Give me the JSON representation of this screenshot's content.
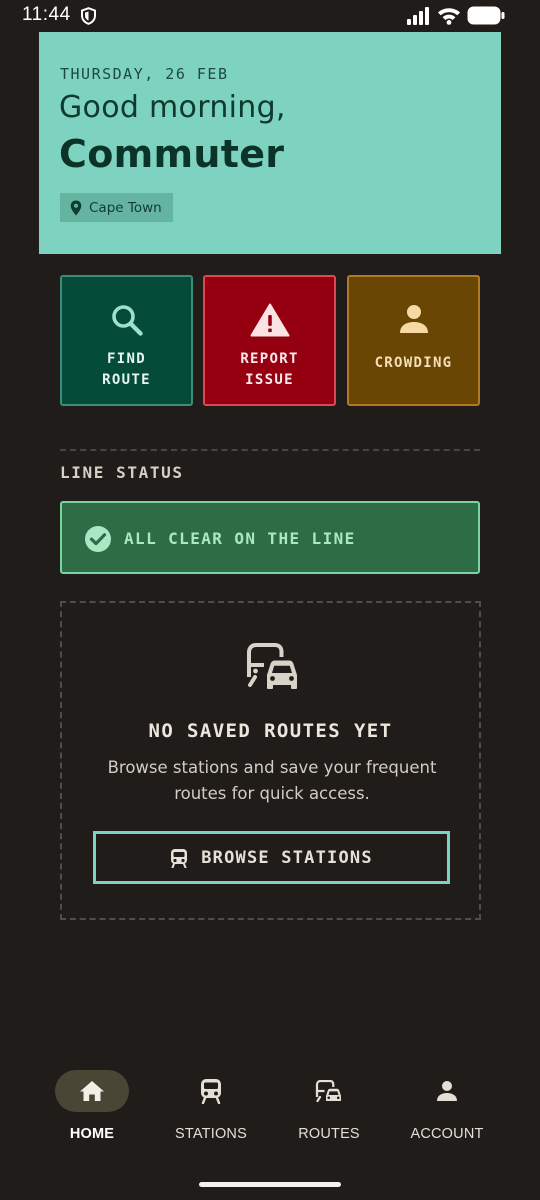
{
  "status_bar": {
    "time": "11:44"
  },
  "hero": {
    "date": "THURSDAY, 26 FEB",
    "greeting": "Good morning,",
    "name": "Commuter",
    "location": "Cape Town"
  },
  "quick_actions": [
    {
      "label": "FIND\nROUTE",
      "icon": "search-icon"
    },
    {
      "label": "REPORT\nISSUE",
      "icon": "warning-icon"
    },
    {
      "label": "CROWDING",
      "icon": "person-icon"
    }
  ],
  "line_status": {
    "title": "LINE STATUS",
    "message": "ALL CLEAR ON THE LINE"
  },
  "saved_routes": {
    "title": "NO SAVED ROUTES YET",
    "description": "Browse stations and save your frequent routes for quick access.",
    "button_label": "BROWSE STATIONS"
  },
  "bottom_nav": [
    {
      "label": "HOME",
      "icon": "home-icon",
      "active": true
    },
    {
      "label": "STATIONS",
      "icon": "train-icon",
      "active": false
    },
    {
      "label": "ROUTES",
      "icon": "commute-icon",
      "active": false
    },
    {
      "label": "ACCOUNT",
      "icon": "account-icon",
      "active": false
    }
  ],
  "colors": {
    "background": "#201c1a",
    "hero": "#7dd3c0",
    "find_route": "#044b3a",
    "report_issue": "#950010",
    "crowding": "#6a4604",
    "line_clear": "#2e6c45",
    "accent_border": "#7dd3c0"
  }
}
